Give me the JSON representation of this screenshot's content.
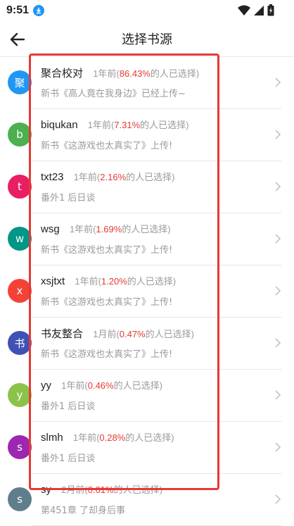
{
  "status": {
    "time": "9:51"
  },
  "header": {
    "title": "选择书源"
  },
  "sources": [
    {
      "avatar": "聚",
      "color": "#2196f3",
      "name": "聚合校对",
      "time": "1年前(",
      "percent": "86.43%",
      "suffix": "的人已选择)",
      "latest": "新书《高人竟在我身边》已经上传~"
    },
    {
      "avatar": "b",
      "color": "#4caf50",
      "name": "biqukan",
      "time": "1年前(",
      "percent": "7.31%",
      "suffix": "的人已选择)",
      "latest": "新书《这游戏也太真实了》上传!"
    },
    {
      "avatar": "t",
      "color": "#e91e63",
      "name": "txt23",
      "time": "1年前(",
      "percent": "2.16%",
      "suffix": "的人已选择)",
      "latest": "番外1 后日谈"
    },
    {
      "avatar": "w",
      "color": "#009688",
      "name": "wsg",
      "time": "1年前(",
      "percent": "1.69%",
      "suffix": "的人已选择)",
      "latest": "新书《这游戏也太真实了》上传!"
    },
    {
      "avatar": "x",
      "color": "#f44336",
      "name": "xsjtxt",
      "time": "1年前(",
      "percent": "1.20%",
      "suffix": "的人已选择)",
      "latest": "新书《这游戏也太真实了》上传!"
    },
    {
      "avatar": "书",
      "color": "#3f51b5",
      "name": "书友整合",
      "time": "1月前(",
      "percent": "0.47%",
      "suffix": "的人已选择)",
      "latest": "新书《这游戏也太真实了》上传!"
    },
    {
      "avatar": "y",
      "color": "#8bc34a",
      "name": "yy",
      "time": "1年前(",
      "percent": "0.46%",
      "suffix": "的人已选择)",
      "latest": "番外1 后日谈"
    },
    {
      "avatar": "s",
      "color": "#9c27b0",
      "name": "slmh",
      "time": "1年前(",
      "percent": "0.28%",
      "suffix": "的人已选择)",
      "latest": "番外1 后日谈"
    },
    {
      "avatar": "s",
      "color": "#607d8b",
      "name": "sy",
      "time": "2月前(",
      "percent": "0.01%",
      "suffix": "的人已选择)",
      "latest": "第451章 了却身后事"
    }
  ]
}
